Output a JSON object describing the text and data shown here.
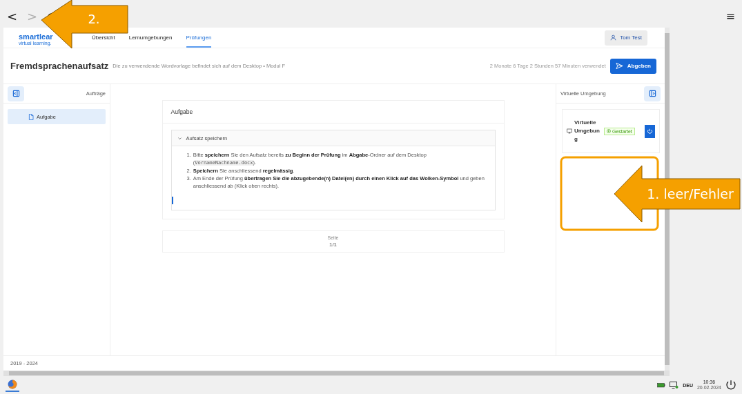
{
  "browser": {
    "back": "<",
    "forward": ">",
    "forward_disabled": true,
    "menu": "≡"
  },
  "app": {
    "logo": {
      "name": "smartlear",
      "tagline": "virtual learning."
    },
    "nav": [
      {
        "label": "Übersicht",
        "selected": false
      },
      {
        "label": "Lernumgebungen",
        "selected": false
      },
      {
        "label": "Prüfungen",
        "selected": true
      }
    ],
    "user": "Tom Test",
    "exam": {
      "title": "Fremdsprachenaufsatz",
      "subtitle": "Die zu verwendende Wordvorlage befindet sich auf dem Desktop • Modul F",
      "time_used": "2 Monate 6 Tage 2 Stunden 57 Minuten verwendet",
      "submit": "Abgeben"
    },
    "left_panel": {
      "title": "Aufträge",
      "items": [
        {
          "label": "Aufgabe",
          "selected": true
        }
      ]
    },
    "task": {
      "title": "Aufgabe",
      "section": {
        "title": "Aufsatz speichern",
        "expanded": true,
        "items": [
          {
            "number": "1.",
            "segments": [
              {
                "kind": "text",
                "text": "Bitte **speichern** Sie den Aufsatz bereits **zu Beginn der Prüfung** im **Abgabe**-Ordner auf dem Desktop ("
              },
              {
                "kind": "code",
                "text": "VornameNachname.docx"
              },
              {
                "kind": "text",
                "text": ")."
              }
            ]
          },
          {
            "number": "2.",
            "segments": [
              {
                "kind": "text",
                "text": "**Speichern** Sie anschliessend **regelmässig**."
              }
            ]
          },
          {
            "number": "3.",
            "segments": [
              {
                "kind": "text",
                "text": "Am Ende der Prüfung **übertragen Sie die abzugebende(n) Datei(en) durch einen Klick auf das Wolken-Symbol** und geben anschliessend ab (Klick oben rechts)."
              }
            ]
          }
        ]
      }
    },
    "pager": {
      "label": "Seite",
      "value": "1/1"
    },
    "right_panel": {
      "title": "Virtuelle Umgebung",
      "environments": [
        {
          "name": "Virtuelle Umgebung",
          "status": {
            "label": "Gestartet",
            "kind": "running"
          }
        }
      ]
    },
    "footer": "2019 - 2024"
  },
  "taskbar": {
    "language": "DEU",
    "time": "10:36",
    "date": "20.02.2024"
  },
  "annotations": [
    {
      "kind": "arrow",
      "label": "2."
    },
    {
      "kind": "frame"
    },
    {
      "kind": "arrow",
      "label": "1. leer/Fehler"
    }
  ]
}
